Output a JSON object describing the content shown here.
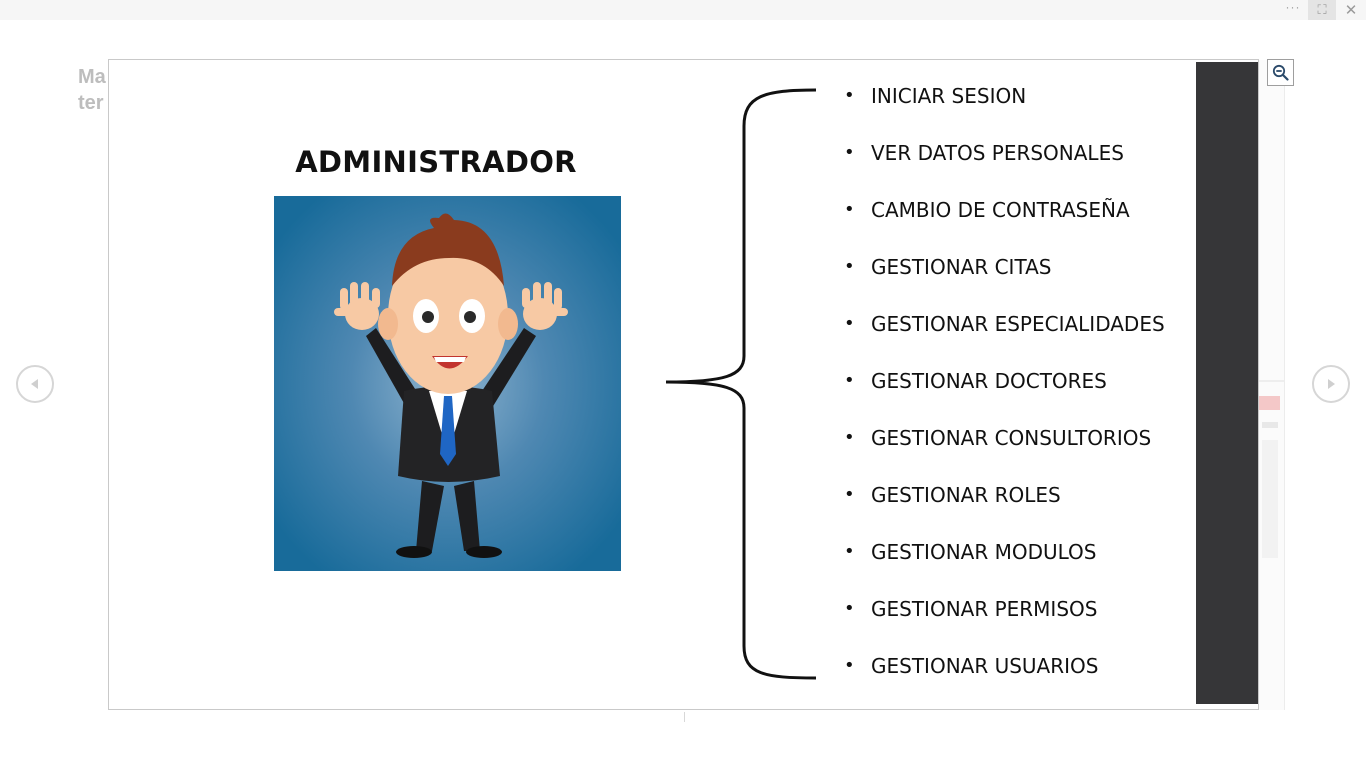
{
  "window": {
    "more_label": "···",
    "fit_label": "⛶",
    "close_label": "✕"
  },
  "background": {
    "title_line1": "Ma",
    "title_line2": "ter"
  },
  "slide": {
    "role_title": "ADMINISTRADOR",
    "bullet_char": "•",
    "items": [
      {
        "label": "INICIAR SESION"
      },
      {
        "label": "VER DATOS PERSONALES"
      },
      {
        "label": "CAMBIO DE CONTRASEÑA"
      },
      {
        "label": "GESTIONAR CITAS"
      },
      {
        "label": "GESTIONAR ESPECIALIDADES"
      },
      {
        "label": "GESTIONAR DOCTORES"
      },
      {
        "label": "GESTIONAR CONSULTORIOS"
      },
      {
        "label": "GESTIONAR ROLES"
      },
      {
        "label": "GESTIONAR MODULOS"
      },
      {
        "label": "GESTIONAR PERMISOS"
      },
      {
        "label": "GESTIONAR USUARIOS"
      }
    ]
  },
  "icons": {
    "zoom": "zoom-out-icon",
    "prev": "chevron-left-icon",
    "next": "chevron-right-icon"
  },
  "colors": {
    "avatar_bg": "#1a6e9c",
    "dark_strip": "#363638",
    "arrow": "#cfcfcf"
  }
}
